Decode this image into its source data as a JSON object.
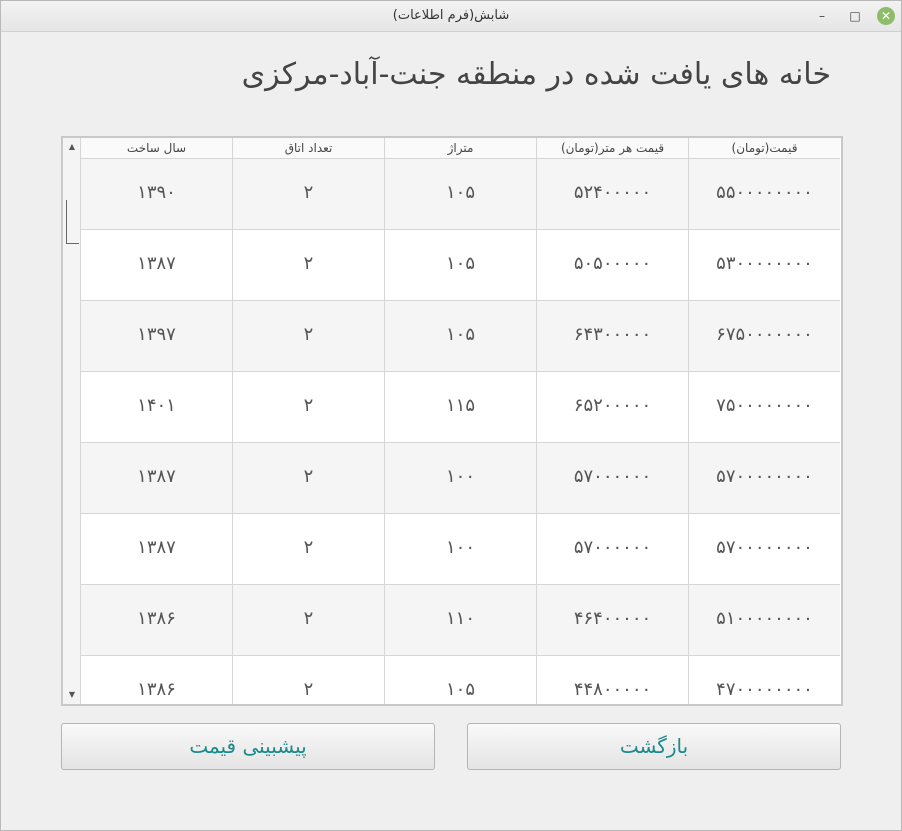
{
  "window": {
    "title": "شابش(فرم اطلاعات)",
    "minimize_glyph": "–",
    "maximize_glyph": "□",
    "close_glyph": "✕"
  },
  "heading": "خانه های یافت شده در منطقه جنت-آباد-مرکزی",
  "table": {
    "columns": [
      "قیمت(تومان)",
      "قیمت هر متر(تومان)",
      "متراژ",
      "تعداد اتاق",
      "سال ساخت"
    ],
    "rows": [
      [
        "۵۵۰۰۰۰۰۰۰۰",
        "۵۲۴۰۰۰۰۰",
        "۱۰۵",
        "۲",
        "۱۳۹۰"
      ],
      [
        "۵۳۰۰۰۰۰۰۰۰",
        "۵۰۵۰۰۰۰۰",
        "۱۰۵",
        "۲",
        "۱۳۸۷"
      ],
      [
        "۶۷۵۰۰۰۰۰۰۰",
        "۶۴۳۰۰۰۰۰",
        "۱۰۵",
        "۲",
        "۱۳۹۷"
      ],
      [
        "۷۵۰۰۰۰۰۰۰۰",
        "۶۵۲۰۰۰۰۰",
        "۱۱۵",
        "۲",
        "۱۴۰۱"
      ],
      [
        "۵۷۰۰۰۰۰۰۰۰",
        "۵۷۰۰۰۰۰۰",
        "۱۰۰",
        "۲",
        "۱۳۸۷"
      ],
      [
        "۵۷۰۰۰۰۰۰۰۰",
        "۵۷۰۰۰۰۰۰",
        "۱۰۰",
        "۲",
        "۱۳۸۷"
      ],
      [
        "۵۱۰۰۰۰۰۰۰۰",
        "۴۶۴۰۰۰۰۰",
        "۱۱۰",
        "۲",
        "۱۳۸۶"
      ],
      [
        "۴۷۰۰۰۰۰۰۰۰",
        "۴۴۸۰۰۰۰۰",
        "۱۰۵",
        "۲",
        "۱۳۸۶"
      ]
    ]
  },
  "scrollbar": {
    "up_glyph": "▲",
    "down_glyph": "▼"
  },
  "buttons": {
    "back_label": "بازگشت",
    "predict_label": "پیشبینی قیمت"
  },
  "colors": {
    "button_text": "#1a8a8a",
    "close_button": "#8ebd6a"
  }
}
